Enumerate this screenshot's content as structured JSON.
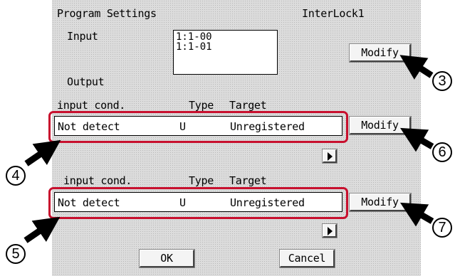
{
  "header": {
    "title": "Program Settings",
    "program_name": "InterLock1"
  },
  "input_section": {
    "label": "Input",
    "items": [
      "1:1-00",
      "1:1-01"
    ],
    "modify_label": "Modify"
  },
  "output_section": {
    "label": "Output",
    "rows": [
      {
        "header_cond": "input cond.",
        "header_type": "Type",
        "header_target": "Target",
        "cond": "Not detect",
        "type": "U",
        "target": "Unregistered",
        "modify_label": "Modify"
      },
      {
        "header_cond": "input cond.",
        "header_type": "Type",
        "header_target": "Target",
        "cond": "Not detect",
        "type": "U",
        "target": "Unregistered",
        "modify_label": "Modify"
      }
    ]
  },
  "footer": {
    "ok_label": "OK",
    "cancel_label": "Cancel"
  },
  "callouts": [
    "3",
    "4",
    "5",
    "6",
    "7"
  ],
  "colors": {
    "highlight": "#c8102e",
    "panel_background": "#dcdcdc"
  }
}
